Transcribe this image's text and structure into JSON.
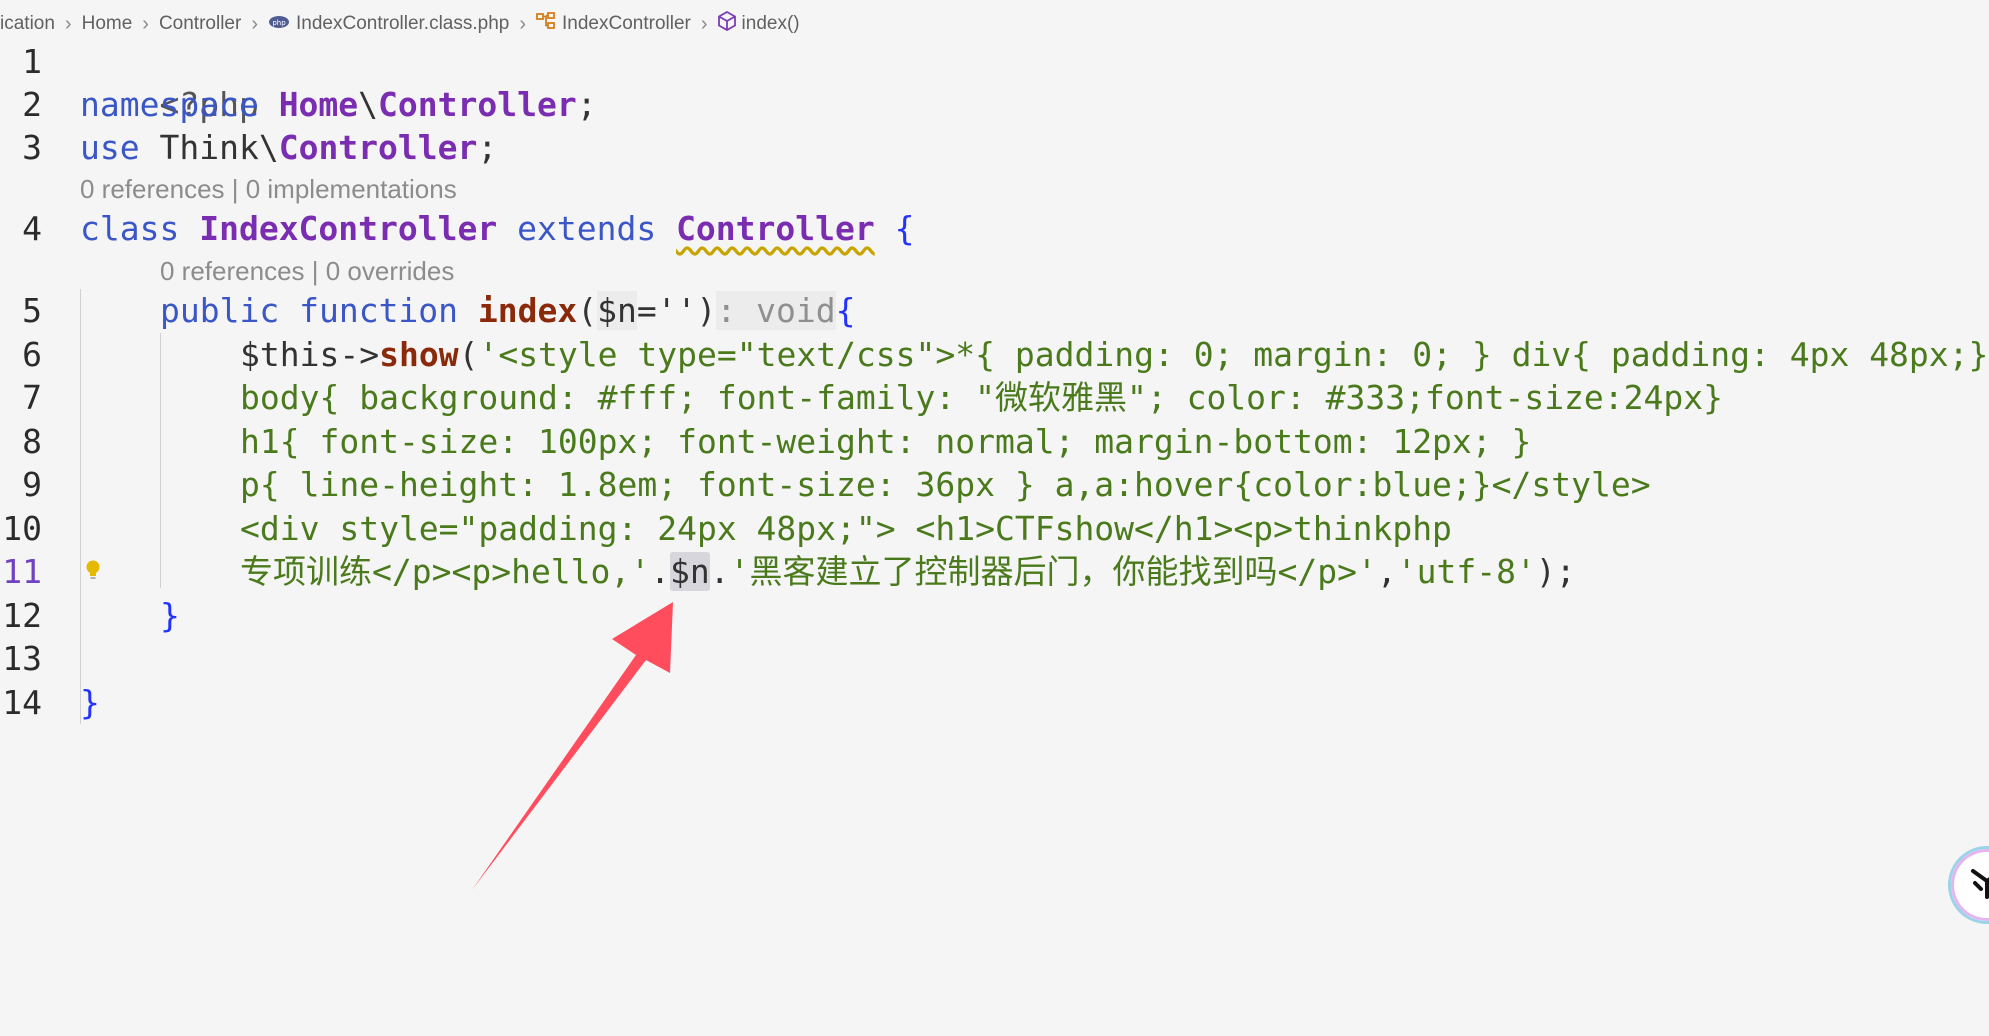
{
  "breadcrumb": {
    "items": [
      "ication",
      "Home",
      "Controller",
      "IndexController.class.php",
      "IndexController",
      "index()"
    ],
    "icons": [
      "php-file-icon",
      "class-icon",
      "method-icon"
    ]
  },
  "editor": {
    "line_numbers": [
      "1",
      "2",
      "3",
      "4",
      "5",
      "6",
      "7",
      "8",
      "9",
      "10",
      "11",
      "12",
      "13",
      "14"
    ],
    "active_line": "11",
    "lens_class": "0 references | 0 implementations",
    "lens_method": "0 references | 0 overrides",
    "tokens": {
      "l1": "<?php",
      "l2_kw": "namespace",
      "l2_ns1": "Home",
      "l2_bs": "\\",
      "l2_ns2": "Controller",
      "l2_semi": ";",
      "l3_kw": "use",
      "l3_ns1": "Think",
      "l3_bs": "\\",
      "l3_ns2": "Controller",
      "l3_semi": ";",
      "l4_kw": "class",
      "l4_name": "IndexController",
      "l4_ext": "extends",
      "l4_parent": "Controller",
      "l4_brace": "{",
      "l5_pub": "public",
      "l5_fn": "function",
      "l5_name": "index",
      "l5_open": "(",
      "l5_param": "$n",
      "l5_eq": "=''",
      "l5_close": ")",
      "l5_hint": ": void",
      "l5_brace": "{",
      "l6_this": "$this",
      "l6_arrow": "->",
      "l6_show": "show",
      "l6_open": "(",
      "l6_str": "'<style type=\"text/css\">*{ padding: 0; margin: 0; } div{ padding: 4px 48px;}",
      "l7_str": "body{ background: #fff; font-family: \"微软雅黑\"; color: #333;font-size:24px}",
      "l8_str": "h1{ font-size: 100px; font-weight: normal; margin-bottom: 12px; }",
      "l9_str": "p{ line-height: 1.8em; font-size: 36px } a,a:hover{color:blue;}</style>",
      "l10_str": "<div style=\"padding: 24px 48px;\"> <h1>CTFshow</h1><p>thinkphp",
      "l11_str1": "专项训练</p><p>hello,'",
      "l11_dot1": ".",
      "l11_var": "$n",
      "l11_dot2": ".",
      "l11_str2": "'黑客建立了控制器后门，你能找到吗</p>'",
      "l11_comma": ",",
      "l11_str3": "'utf-8'",
      "l11_end": ");",
      "l12": "}",
      "l14": "}"
    }
  },
  "colors": {
    "annotation_arrow": "#ff4d5e",
    "keyword": "#3b56c7",
    "class_name": "#7a2db0",
    "string": "#4a7a1c",
    "function_name": "#8a2a0a"
  }
}
